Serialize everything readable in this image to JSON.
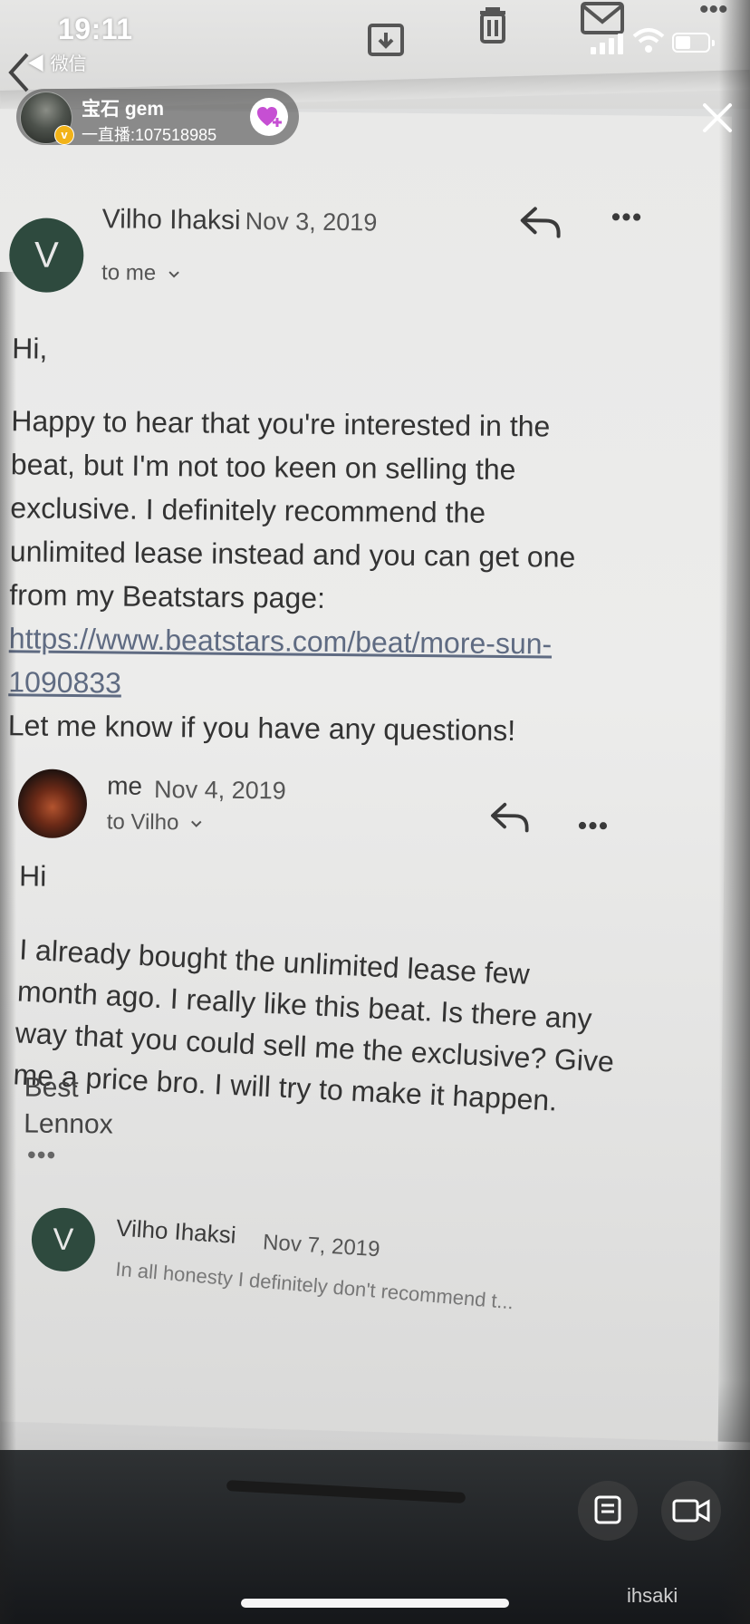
{
  "status_bar": {
    "time": "19:11",
    "back_app": "微信"
  },
  "live": {
    "name": "宝石 gem",
    "id_text": "一直播:107518985"
  },
  "thread": [
    {
      "avatar_letter": "V",
      "sender": "Vilho Ihaksi",
      "date": "Nov 3, 2019",
      "recipient": "to me",
      "greeting": "Hi,",
      "body_lines": [
        "Happy to hear that you're interested in the",
        "beat, but I'm not too keen on selling the",
        "exclusive. I definitely recommend the",
        "unlimited lease instead and you can get one",
        "from my Beatstars page:"
      ],
      "link_lines": [
        "https://www.beatstars.com/beat/more-sun-",
        "1090833"
      ],
      "closing": "Let me know if you have any questions!",
      "ellipsis": "•••"
    },
    {
      "sender": "me",
      "date": "Nov 4, 2019",
      "recipient": "to Vilho",
      "greeting": "Hi",
      "body_lines": [
        "I already bought the unlimited lease few",
        "month ago. I really like this beat. Is there any",
        "way that you could sell me the exclusive? Give",
        "me a price bro. I will try to make it happen."
      ],
      "signoff": "Best",
      "signature": "Lennox",
      "ellipsis": "•••"
    },
    {
      "avatar_letter": "V",
      "sender": "Vilho Ihaksi",
      "date": "Nov 7, 2019",
      "snippet": "In all honesty I definitely don't recommend t..."
    }
  ],
  "overflow_dots": "•••",
  "watermark": "ihsaki"
}
